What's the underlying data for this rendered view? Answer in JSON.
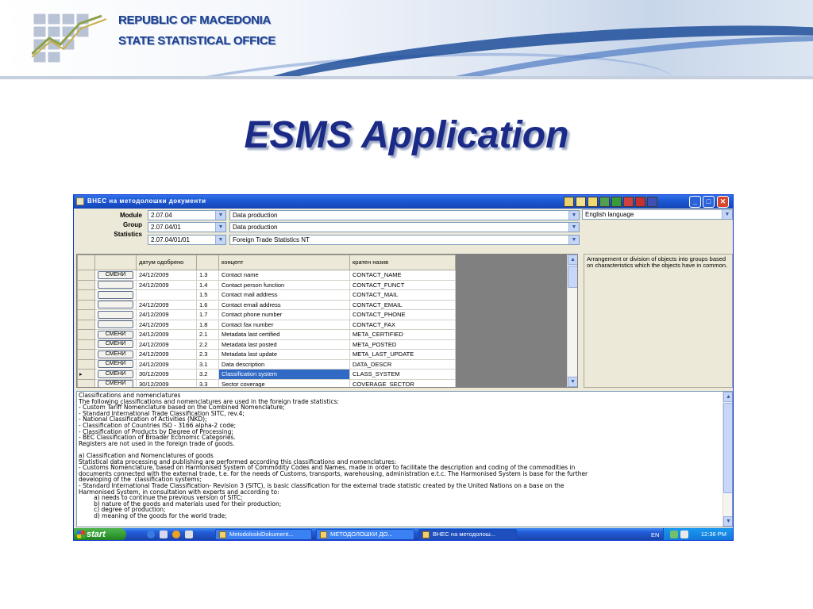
{
  "header": {
    "org_line1": "REPUBLIC OF MACEDONIA",
    "org_line2": "STATE STATISTICAL OFFICE"
  },
  "slide_title": "ESMS Application",
  "window": {
    "title": "ВНЕС на методолошки документи",
    "labels": {
      "module": "Module",
      "group": "Group",
      "statistics": "Statistics"
    },
    "combos": {
      "module_code": "2.07.04",
      "module_name": "Data production",
      "group_code": "2.07.04/01",
      "group_name": "Data production",
      "stat_code": "2.07.04/01/01",
      "stat_name": "Foreign Trade Statistics NT",
      "language": "English language"
    },
    "grid": {
      "headers": {
        "date": "датум одобрено",
        "concept": "концепт",
        "short": "кратен назив"
      },
      "button_label": "СМЕНИ",
      "selected_marker": "▸",
      "rows": [
        {
          "btn": true,
          "date": "24/12/2009",
          "num": "1.3",
          "concept": "Contact name",
          "short": "CONTACT_NAME"
        },
        {
          "btn": false,
          "date": "24/12/2009",
          "num": "1.4",
          "concept": "Contact person function",
          "short": "CONTACT_FUNCT"
        },
        {
          "btn": false,
          "date": "",
          "num": "1.5",
          "concept": "Contact mail address",
          "short": "CONTACT_MAIL"
        },
        {
          "btn": false,
          "date": "24/12/2009",
          "num": "1.6",
          "concept": "Contact email address",
          "short": "CONTACT_EMAIL"
        },
        {
          "btn": false,
          "date": "24/12/2009",
          "num": "1.7",
          "concept": "Contact phone number",
          "short": "CONTACT_PHONE"
        },
        {
          "btn": false,
          "date": "24/12/2009",
          "num": "1.8",
          "concept": "Contact fax number",
          "short": "CONTACT_FAX"
        },
        {
          "btn": true,
          "date": "24/12/2009",
          "num": "2.1",
          "concept": "Metadata last certified",
          "short": "META_CERTIFIED"
        },
        {
          "btn": true,
          "date": "24/12/2009",
          "num": "2.2",
          "concept": "Metadata last posted",
          "short": "META_POSTED"
        },
        {
          "btn": true,
          "date": "24/12/2009",
          "num": "2.3",
          "concept": "Metadata last update",
          "short": "META_LAST_UPDATE"
        },
        {
          "btn": true,
          "date": "24/12/2009",
          "num": "3.1",
          "concept": "Data description",
          "short": "DATA_DESCR"
        },
        {
          "btn": true,
          "date": "30/12/2009",
          "num": "3.2",
          "concept": "Classification system",
          "short": "CLASS_SYSTEM",
          "selected": true
        },
        {
          "btn": true,
          "date": "30/12/2009",
          "num": "3.3",
          "concept": "Sector coverage",
          "short": "COVERAGE_SECTOR"
        }
      ]
    },
    "definition": "Arrangement or division of objects into groups based on characteristics which the objects have in common.",
    "text_lines": [
      "Classifications and nomenclatures",
      "The following classifications and nomenclatures are used in the foreign trade statistics:",
      "- Custom Tariff Nomenclature based on the Combined Nomenclature;",
      "- Standard International Trade Classification SITC, rev.4;",
      "- National Classification of Activities (NKD);",
      "- Classification of Countries ISO - 3166 alpha-2 code;",
      "- Classification of Products by Degree of Processing;",
      "- BEC Classification of Broader Economic Categories.",
      "Registers are not used in the foreign trade of goods.",
      "",
      "a) Classification and Nomenclatures of goods",
      "Statistical data processing and publishing are performed according this classifications and nomenclatures:",
      "- Customs Nomenclature, based on Harmonised System of Commodity Codes and Names, made in order to facilitate the description and coding of the commodities in",
      "documents connected with the external trade, t.e. for the needs of Customs, transports, warehousing, administration e.t.c. The Harmonised System is base for the further",
      "developing of the  classification systems;",
      "- Standard International Trade Classification- Revision 3 (SITC), is basic classification for the external trade statistic created by the United Nations on a base on the",
      "Harmonised System, in consultation with experts and according to:",
      "        a) needs to continue the previous version of SITC;",
      "        b) nature of the goods and materials used for their production;",
      "        c) degree of production;",
      "        d) meaning of the goods for the world trade;"
    ]
  },
  "taskbar": {
    "start_label": "start",
    "buttons": [
      {
        "label": "MetodoloskiDokument..."
      },
      {
        "label": "МЕТОДОЛОШКИ ДО..."
      },
      {
        "label": "ВНЕС на методолош..."
      }
    ],
    "language": "EN",
    "clock": "12:36 PM"
  }
}
